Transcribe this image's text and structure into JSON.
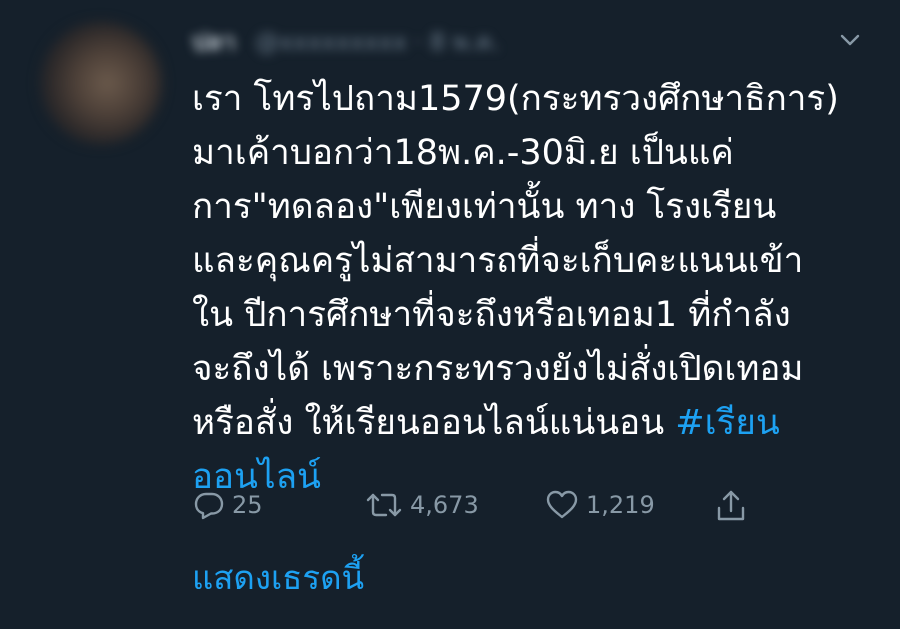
{
  "tweet": {
    "author_name": "ปลา",
    "author_handle": "@xxxxxxxxx · 8 พ.ค.",
    "text_before_hashtag": "เรา โทรไปถาม1579(กระทรวงศึกษาธิการ)\nมาเค้าบอกว่า18พ.ค.-30มิ.ย เป็นแค่\nการ\"ทดลอง\"เพียงเท่านั้น ทาง โรงเรียน\nและคุณครูไม่สามารถที่จะเก็บคะแนนเข้า\nใน ปีการศึกษาที่จะถึงหรือเทอม1 ที่กำลัง\nจะถึงได้ เพราะกระทรวงยังไม่สั่งเปิดเทอม\nหรือสั่ง ให้เรียนออนไลน์แน่นอน ",
    "hashtag": "#เรียน\nออนไลน์",
    "replies": "25",
    "retweets": "4,673",
    "likes": "1,219",
    "show_thread": "แสดงเธรดนี้"
  },
  "icons": {
    "caret": "chevron-down-icon",
    "reply": "reply-icon",
    "retweet": "retweet-icon",
    "like": "heart-icon",
    "share": "share-icon"
  },
  "colors": {
    "background": "#15202b",
    "text": "#ffffff",
    "muted": "#8899a6",
    "accent": "#1da1f2"
  }
}
